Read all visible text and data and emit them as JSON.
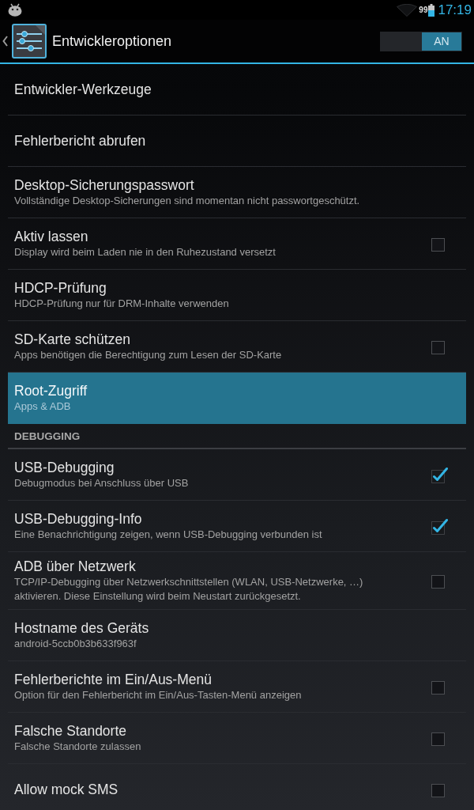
{
  "status_bar": {
    "battery_text": "99",
    "time": "17:19"
  },
  "action_bar": {
    "title": "Entwickleroptionen",
    "switch": {
      "label": "AN",
      "on": true
    }
  },
  "preferences": [
    {
      "kind": "plain",
      "title": "Entwickler-Werkzeuge",
      "selected": false
    },
    {
      "kind": "plain",
      "title": "Fehlerbericht abrufen",
      "selected": false
    },
    {
      "kind": "plain",
      "title": "Desktop-Sicherungspasswort",
      "summary": "Vollständige Desktop-Sicherungen sind momentan nicht passwortgeschützt.",
      "selected": false
    },
    {
      "kind": "checkbox",
      "title": "Aktiv lassen",
      "summary": "Display wird beim Laden nie in den Ruhezustand versetzt",
      "checked": false,
      "selected": false
    },
    {
      "kind": "plain",
      "title": "HDCP-Prüfung",
      "summary": "HDCP-Prüfung nur für DRM-Inhalte verwenden",
      "selected": false
    },
    {
      "kind": "checkbox",
      "title": "SD-Karte schützen",
      "summary": "Apps benötigen die Berechtigung zum Lesen der SD-Karte",
      "checked": false,
      "selected": false
    },
    {
      "kind": "plain",
      "title": "Root-Zugriff",
      "summary": "Apps & ADB",
      "selected": true
    },
    {
      "kind": "category",
      "title": "DEBUGGING"
    },
    {
      "kind": "checkbox",
      "title": "USB-Debugging",
      "summary": "Debugmodus bei Anschluss über USB",
      "checked": true,
      "selected": false
    },
    {
      "kind": "checkbox",
      "title": "USB-Debugging-Info",
      "summary": "Eine Benachrichtigung zeigen, wenn USB-Debugging verbunden ist",
      "checked": true,
      "selected": false
    },
    {
      "kind": "checkbox",
      "title": "ADB über Netzwerk",
      "summary": "TCP/IP-Debugging über Netzwerkschnittstellen (WLAN, USB-Netzwerke, …) aktivieren. Diese Einstellung wird beim Neustart zurückgesetzt.",
      "checked": false,
      "selected": false
    },
    {
      "kind": "plain",
      "title": "Hostname des Geräts",
      "summary": "android-5ccb0b3b633f963f",
      "selected": false
    },
    {
      "kind": "checkbox",
      "title": "Fehlerberichte im Ein/Aus-Menü",
      "summary": "Option für den Fehlerbericht im Ein/Aus-Tasten-Menü anzeigen",
      "checked": false,
      "selected": false
    },
    {
      "kind": "checkbox",
      "title": "Falsche Standorte",
      "summary": "Falsche Standorte zulassen",
      "checked": false,
      "selected": false
    },
    {
      "kind": "checkbox",
      "title": "Allow mock SMS",
      "checked": false,
      "selected": false
    }
  ]
}
